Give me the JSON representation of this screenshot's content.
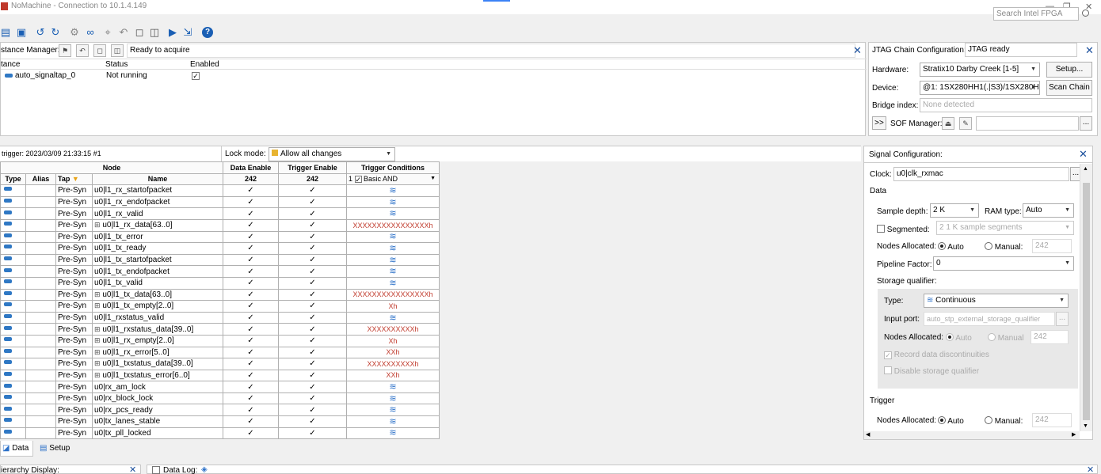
{
  "window": {
    "title": "NoMachine - Connection to 10.1.4.149",
    "search_placeholder": "Search Intel FPGA",
    "min_glyph": "—",
    "restore_glyph": "❐",
    "close_glyph": "✕"
  },
  "toolbar": {
    "icons": [
      "open-icon",
      "save-icon",
      "undo-icon",
      "redo-icon",
      "hierarchy-icon",
      "binoculars-icon",
      "node-finder-icon",
      "back-icon",
      "stop-icon",
      "book-icon",
      "run-icon",
      "autorun-icon",
      "help-icon"
    ],
    "help_glyph": "?"
  },
  "instance_manager": {
    "label": "stance Manager:",
    "status_text": "Ready to acquire",
    "columns": [
      "tance",
      "Status",
      "Enabled"
    ],
    "rows": [
      {
        "name": "auto_signaltap_0",
        "status": "Not running",
        "enabled": "✓"
      }
    ]
  },
  "jtag": {
    "label": "JTAG Chain Configuration:",
    "status": "JTAG ready",
    "hardware_label": "Hardware:",
    "hardware_value": "Stratix10 Darby Creek [1-5]",
    "setup_button": "Setup...",
    "device_label": "Device:",
    "device_value": "@1: 1SX280HH1(.|S3)/1SX280H",
    "scan_button": "Scan Chain",
    "bridge_label": "Bridge index:",
    "bridge_value": "None detected",
    "expand_button": ">>",
    "sof_label": "SOF Manager:",
    "browse_button": "..."
  },
  "node_list": {
    "trigger_info": "trigger: 2023/03/09 21:33:15  #1",
    "lock_mode_label": "Lock mode:",
    "lock_mode_value": "Allow all changes",
    "header_node": "Node",
    "header_data_enable": "Data Enable",
    "header_trigger_enable": "Trigger Enable",
    "header_trigger_conditions": "Trigger Conditions",
    "col_type": "Type",
    "col_alias": "Alias",
    "col_tap": "Tap",
    "col_name": "Name",
    "data_enable_count": "242",
    "trigger_enable_count": "242",
    "trigger_cond_index": "1",
    "trigger_cond_value": "Basic AND",
    "rows": [
      {
        "tap": "Pre-Syn",
        "name": "u0|l1_rx_startofpacket",
        "bus": false,
        "cond": "≋"
      },
      {
        "tap": "Pre-Syn",
        "name": "u0|l1_rx_endofpacket",
        "bus": false,
        "cond": "≋"
      },
      {
        "tap": "Pre-Syn",
        "name": "u0|l1_rx_valid",
        "bus": false,
        "cond": "≋"
      },
      {
        "tap": "Pre-Syn",
        "name": "u0|l1_rx_data[63..0]",
        "bus": true,
        "cond": "XXXXXXXXXXXXXXXXh"
      },
      {
        "tap": "Pre-Syn",
        "name": "u0|l1_tx_error",
        "bus": false,
        "cond": "≋"
      },
      {
        "tap": "Pre-Syn",
        "name": "u0|l1_tx_ready",
        "bus": false,
        "cond": "≋"
      },
      {
        "tap": "Pre-Syn",
        "name": "u0|l1_tx_startofpacket",
        "bus": false,
        "cond": "≋"
      },
      {
        "tap": "Pre-Syn",
        "name": "u0|l1_tx_endofpacket",
        "bus": false,
        "cond": "≋"
      },
      {
        "tap": "Pre-Syn",
        "name": "u0|l1_tx_valid",
        "bus": false,
        "cond": "≋"
      },
      {
        "tap": "Pre-Syn",
        "name": "u0|l1_tx_data[63..0]",
        "bus": true,
        "cond": "XXXXXXXXXXXXXXXXh"
      },
      {
        "tap": "Pre-Syn",
        "name": "u0|l1_tx_empty[2..0]",
        "bus": true,
        "cond": "Xh"
      },
      {
        "tap": "Pre-Syn",
        "name": "u0|l1_rxstatus_valid",
        "bus": false,
        "cond": "≋"
      },
      {
        "tap": "Pre-Syn",
        "name": "u0|l1_rxstatus_data[39..0]",
        "bus": true,
        "cond": "XXXXXXXXXXh"
      },
      {
        "tap": "Pre-Syn",
        "name": "u0|l1_rx_empty[2..0]",
        "bus": true,
        "cond": "Xh"
      },
      {
        "tap": "Pre-Syn",
        "name": "u0|l1_rx_error[5..0]",
        "bus": true,
        "cond": "XXh"
      },
      {
        "tap": "Pre-Syn",
        "name": "u0|l1_txstatus_data[39..0]",
        "bus": true,
        "cond": "XXXXXXXXXXh"
      },
      {
        "tap": "Pre-Syn",
        "name": "u0|l1_txstatus_error[6..0]",
        "bus": true,
        "cond": "XXh"
      },
      {
        "tap": "Pre-Syn",
        "name": "u0|rx_am_lock",
        "bus": false,
        "cond": "≋"
      },
      {
        "tap": "Pre-Syn",
        "name": "u0|rx_block_lock",
        "bus": false,
        "cond": "≋"
      },
      {
        "tap": "Pre-Syn",
        "name": "u0|rx_pcs_ready",
        "bus": false,
        "cond": "≋"
      },
      {
        "tap": "Pre-Syn",
        "name": "u0|tx_lanes_stable",
        "bus": false,
        "cond": "≋"
      },
      {
        "tap": "Pre-Syn",
        "name": "u0|tx_pll_locked",
        "bus": false,
        "cond": "≋"
      }
    ]
  },
  "signal_config": {
    "title": "Signal Configuration:",
    "clock_label": "Clock:",
    "clock_value": "u0|clk_rxmac",
    "data_heading": "Data",
    "sample_depth_label": "Sample depth:",
    "sample_depth_value": "2 K",
    "ram_type_label": "RAM type:",
    "ram_type_value": "Auto",
    "segmented_label": "Segmented:",
    "segmented_value": "2  1 K sample segments",
    "nodes_alloc_label": "Nodes Allocated:",
    "auto_label": "Auto",
    "manual_label": "Manual:",
    "manual_value": "242",
    "pipeline_label": "Pipeline Factor:",
    "pipeline_value": "0",
    "storage_label": "Storage qualifier:",
    "type_label": "Type:",
    "type_value": "Continuous",
    "input_port_label": "Input port:",
    "input_port_value": "auto_stp_external_storage_qualifier",
    "sq_nodes_label": "Nodes Allocated:",
    "sq_auto": "Auto",
    "sq_manual": "Manual",
    "sq_manual_value": "242",
    "record_label": "Record data discontinuities",
    "disable_label": "Disable storage qualifier",
    "trigger_heading": "Trigger",
    "trig_nodes_label": "Nodes Allocated:",
    "trig_auto": "Auto",
    "trig_manual": "Manual:",
    "trig_manual_value": "242"
  },
  "bottom_tabs": {
    "data": "Data",
    "setup": "Setup"
  },
  "bottom_panels": {
    "hierarchy": "ierarchy Display:",
    "data_log": "Data Log:"
  }
}
